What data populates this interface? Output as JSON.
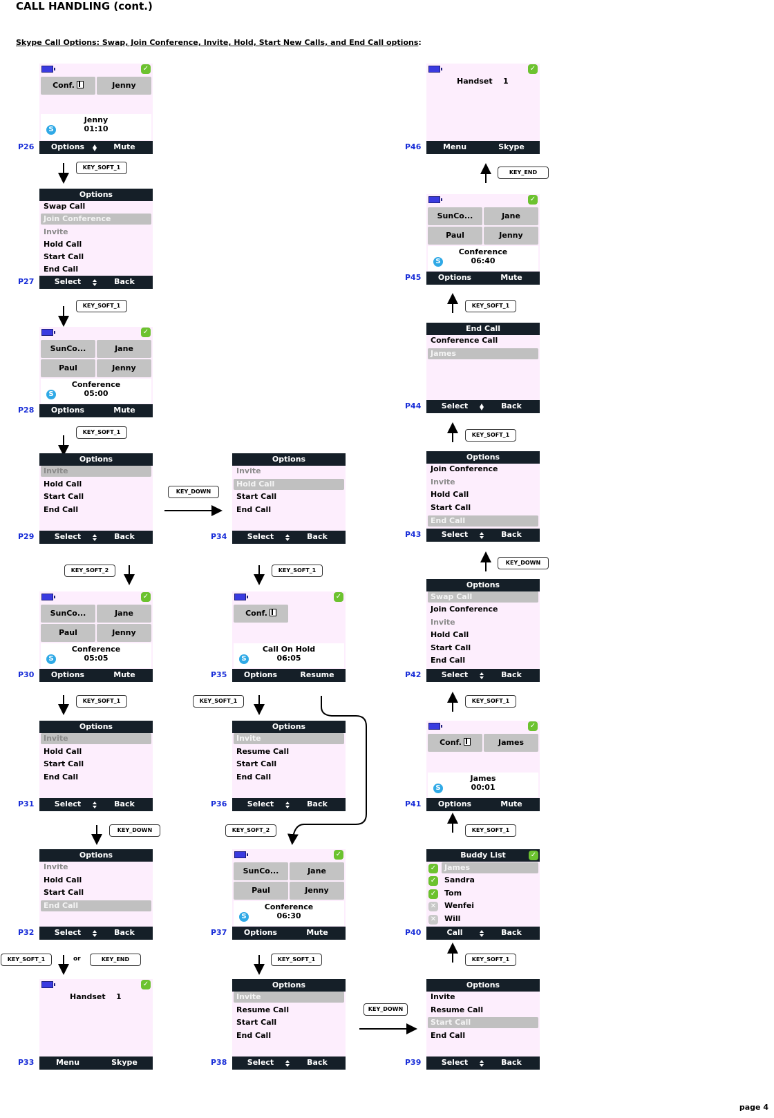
{
  "page": {
    "title": "CALL HANDLING (cont.)",
    "subtitle": "Skype Call Options: Swap, Join Conference, Invite, Hold, Start New Calls, and End Call options",
    "subtitle_colon": ":",
    "page_number": "page 4"
  },
  "icons": {
    "battery": "battery-icon",
    "status": "online-check-icon",
    "skype": "skype-icon",
    "pause": "hold-pause-icon",
    "nav": "up-down-nav-icon",
    "offline": "offline-x-icon"
  },
  "screens": {
    "p26": {
      "id": "P26",
      "tiles": [
        "Conf.",
        "Jenny"
      ],
      "info": [
        "Jenny",
        "01:10"
      ],
      "soft_left": "Options",
      "soft_right": "Mute"
    },
    "p27": {
      "id": "P27",
      "header": "Options",
      "items": [
        "Swap Call",
        "Join Conference",
        "Invite",
        "Hold Call",
        "Start Call",
        "End Call"
      ],
      "soft_left": "Select",
      "soft_right": "Back"
    },
    "p28": {
      "id": "P28",
      "tiles": [
        "SunCo...",
        "Jane",
        "Paul",
        "Jenny"
      ],
      "info": [
        "Conference",
        "05:00"
      ],
      "soft_left": "Options",
      "soft_right": "Mute"
    },
    "p29": {
      "id": "P29",
      "header": "Options",
      "items": [
        "Invite",
        "Hold Call",
        "Start Call",
        "End Call"
      ],
      "soft_left": "Select",
      "soft_right": "Back"
    },
    "p30": {
      "id": "P30",
      "tiles": [
        "SunCo...",
        "Jane",
        "Paul",
        "Jenny"
      ],
      "info": [
        "Conference",
        "05:05"
      ],
      "soft_left": "Options",
      "soft_right": "Mute"
    },
    "p31": {
      "id": "P31",
      "header": "Options",
      "items": [
        "Invite",
        "Hold Call",
        "Start Call",
        "End Call"
      ],
      "soft_left": "Select",
      "soft_right": "Back"
    },
    "p32": {
      "id": "P32",
      "header": "Options",
      "items": [
        "Invite",
        "Hold Call",
        "Start Call",
        "End Call"
      ],
      "soft_left": "Select",
      "soft_right": "Back"
    },
    "p33": {
      "id": "P33",
      "idle_label": "Handset",
      "idle_number": "1",
      "soft_left": "Menu",
      "soft_right": "Skype"
    },
    "p34": {
      "id": "P34",
      "header": "Options",
      "items": [
        "Invite",
        "Hold Call",
        "Start Call",
        "End Call"
      ],
      "soft_left": "Select",
      "soft_right": "Back"
    },
    "p35": {
      "id": "P35",
      "tiles": [
        "Conf."
      ],
      "info": [
        "Call On Hold",
        "06:05"
      ],
      "soft_left": "Options",
      "soft_right": "Resume"
    },
    "p36": {
      "id": "P36",
      "header": "Options",
      "items": [
        "Invite",
        "Resume Call",
        "Start Call",
        "End Call"
      ],
      "soft_left": "Select",
      "soft_right": "Back"
    },
    "p37": {
      "id": "P37",
      "tiles": [
        "SunCo...",
        "Jane",
        "Paul",
        "Jenny"
      ],
      "info": [
        "Conference",
        "06:30"
      ],
      "soft_left": "Options",
      "soft_right": "Mute"
    },
    "p38": {
      "id": "P38",
      "header": "Options",
      "items": [
        "Invite",
        "Resume Call",
        "Start Call",
        "End Call"
      ],
      "soft_left": "Select",
      "soft_right": "Back"
    },
    "p39": {
      "id": "P39",
      "header": "Options",
      "items": [
        "Invite",
        "Resume Call",
        "Start Call",
        "End Call"
      ],
      "soft_left": "Select",
      "soft_right": "Back"
    },
    "p40": {
      "id": "P40",
      "header": "Buddy List",
      "buddies": [
        {
          "name": "James",
          "status": "online"
        },
        {
          "name": "Sandra",
          "status": "online"
        },
        {
          "name": "Tom",
          "status": "online"
        },
        {
          "name": "Wenfei",
          "status": "offline"
        },
        {
          "name": "Will",
          "status": "offline"
        }
      ],
      "soft_left": "Call",
      "soft_right": "Back"
    },
    "p41": {
      "id": "P41",
      "tiles": [
        "Conf.",
        "James"
      ],
      "info": [
        "James",
        "00:01"
      ],
      "soft_left": "Options",
      "soft_right": "Mute"
    },
    "p42": {
      "id": "P42",
      "header": "Options",
      "items": [
        "Swap Call",
        "Join Conference",
        "Invite",
        "Hold Call",
        "Start Call",
        "End Call"
      ],
      "soft_left": "Select",
      "soft_right": "Back"
    },
    "p43": {
      "id": "P43",
      "header": "Options",
      "items": [
        "Join Conference",
        "Invite",
        "Hold Call",
        "Start Call",
        "End Call"
      ],
      "soft_left": "Select",
      "soft_right": "Back"
    },
    "p44": {
      "id": "P44",
      "header": "End Call",
      "items": [
        "Conference Call",
        "James"
      ],
      "soft_left": "Select",
      "soft_right": "Back"
    },
    "p45": {
      "id": "P45",
      "tiles": [
        "SunCo...",
        "Jane",
        "Paul",
        "Jenny"
      ],
      "info": [
        "Conference",
        "06:40"
      ],
      "soft_left": "Options",
      "soft_right": "Mute"
    },
    "p46": {
      "id": "P46",
      "idle_label": "Handset",
      "idle_number": "1",
      "soft_left": "Menu",
      "soft_right": "Skype"
    }
  },
  "keys": {
    "k26": "KEY_SOFT_1",
    "k27": "KEY_SOFT_1",
    "k28": "KEY_SOFT_1",
    "k29_34": "KEY_DOWN",
    "k29": "KEY_SOFT_2",
    "k34": "KEY_SOFT_1",
    "k30": "KEY_SOFT_1",
    "k35": "KEY_SOFT_1",
    "k31": "KEY_DOWN",
    "k36": "KEY_SOFT_2",
    "k32a": "KEY_SOFT_1",
    "k32_or": "or",
    "k32b": "KEY_END",
    "k37": "KEY_SOFT_1",
    "k38_39": "KEY_DOWN",
    "k39": "KEY_SOFT_1",
    "k40": "KEY_SOFT_1",
    "k41": "KEY_SOFT_1",
    "k42": "KEY_DOWN",
    "k43": "KEY_SOFT_1",
    "k44": "KEY_SOFT_1",
    "k45": "KEY_END"
  }
}
